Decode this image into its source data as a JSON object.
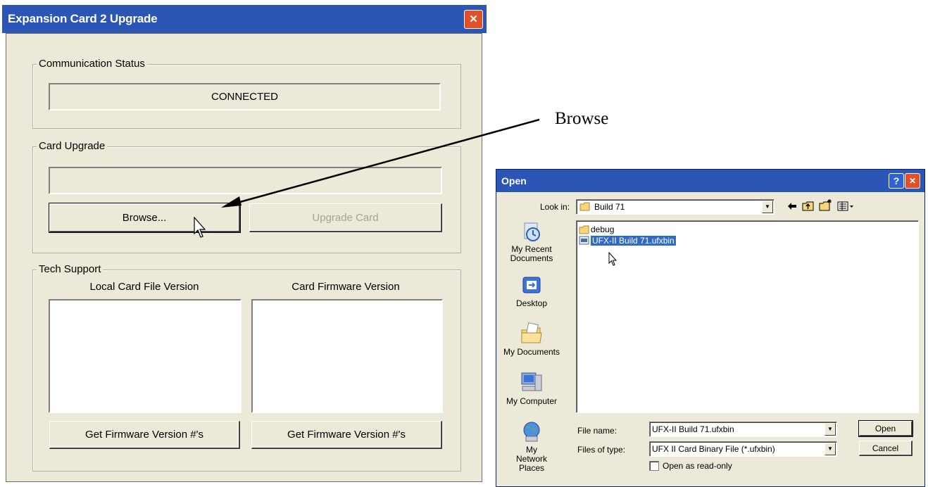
{
  "main_dialog": {
    "title": "Expansion Card 2 Upgrade",
    "close_glyph": "✕",
    "communication": {
      "group_label": "Communication Status",
      "status_text": "CONNECTED"
    },
    "card_upgrade": {
      "group_label": "Card Upgrade",
      "file_path": "",
      "browse_label": "Browse...",
      "upgrade_label": "Upgrade Card"
    },
    "tech_support": {
      "group_label": "Tech Support",
      "local_label": "Local Card File Version",
      "firmware_label": "Card Firmware Version",
      "local_text": "",
      "firmware_text": "",
      "get_local_button": "Get Firmware Version #'s",
      "get_firmware_button": "Get Firmware Version #'s"
    }
  },
  "annotation": {
    "text": "Browse"
  },
  "open_dialog": {
    "title": "Open",
    "help_glyph": "?",
    "close_glyph": "✕",
    "look_in_label": "Look in:",
    "look_in_value": "Build 71",
    "toolbar_icons": [
      "back-icon",
      "up-folder-icon",
      "new-folder-icon",
      "view-menu-icon"
    ],
    "places": [
      {
        "label": "My Recent Documents",
        "icon": "recent-documents-icon"
      },
      {
        "label": "Desktop",
        "icon": "desktop-icon"
      },
      {
        "label": "My Documents",
        "icon": "my-documents-icon"
      },
      {
        "label": "My Computer",
        "icon": "my-computer-icon"
      },
      {
        "label": "My Network Places",
        "icon": "network-places-icon"
      }
    ],
    "files": [
      {
        "name": "debug",
        "icon": "folder-icon",
        "selected": false
      },
      {
        "name": "UFX-II Build 71.ufxbin",
        "icon": "binary-file-icon",
        "selected": true
      }
    ],
    "file_name_label": "File name:",
    "file_name_value": "UFX-II Build 71.ufxbin",
    "file_type_label": "Files of type:",
    "file_type_value": "UFX II Card Binary File (*.ufxbin)",
    "read_only_label": "Open as read-only",
    "read_only_checked": false,
    "open_button": "Open",
    "cancel_button": "Cancel"
  },
  "colors": {
    "titlebar": "#2b56b6",
    "face": "#ece9d8",
    "selection": "#316ac5",
    "close": "#e2502a"
  }
}
